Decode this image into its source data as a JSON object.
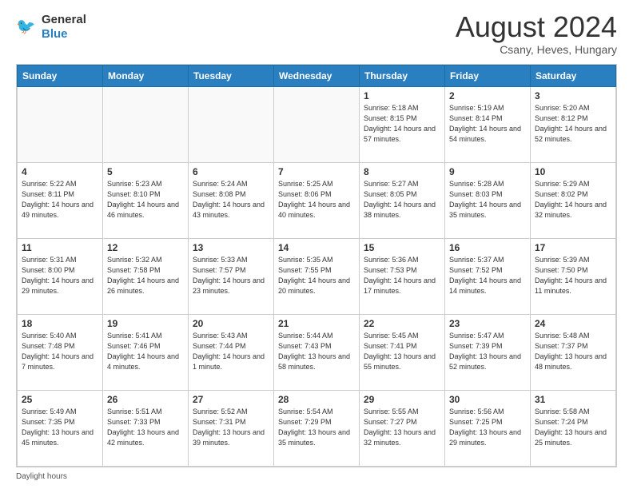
{
  "header": {
    "logo_line1": "General",
    "logo_line2": "Blue",
    "month": "August 2024",
    "location": "Csany, Heves, Hungary"
  },
  "weekdays": [
    "Sunday",
    "Monday",
    "Tuesday",
    "Wednesday",
    "Thursday",
    "Friday",
    "Saturday"
  ],
  "weeks": [
    [
      {
        "day": "",
        "sunrise": "",
        "sunset": "",
        "daylight": "",
        "empty": true
      },
      {
        "day": "",
        "sunrise": "",
        "sunset": "",
        "daylight": "",
        "empty": true
      },
      {
        "day": "",
        "sunrise": "",
        "sunset": "",
        "daylight": "",
        "empty": true
      },
      {
        "day": "",
        "sunrise": "",
        "sunset": "",
        "daylight": "",
        "empty": true
      },
      {
        "day": "1",
        "sunrise": "Sunrise: 5:18 AM",
        "sunset": "Sunset: 8:15 PM",
        "daylight": "Daylight: 14 hours and 57 minutes.",
        "empty": false
      },
      {
        "day": "2",
        "sunrise": "Sunrise: 5:19 AM",
        "sunset": "Sunset: 8:14 PM",
        "daylight": "Daylight: 14 hours and 54 minutes.",
        "empty": false
      },
      {
        "day": "3",
        "sunrise": "Sunrise: 5:20 AM",
        "sunset": "Sunset: 8:12 PM",
        "daylight": "Daylight: 14 hours and 52 minutes.",
        "empty": false
      }
    ],
    [
      {
        "day": "4",
        "sunrise": "Sunrise: 5:22 AM",
        "sunset": "Sunset: 8:11 PM",
        "daylight": "Daylight: 14 hours and 49 minutes.",
        "empty": false
      },
      {
        "day": "5",
        "sunrise": "Sunrise: 5:23 AM",
        "sunset": "Sunset: 8:10 PM",
        "daylight": "Daylight: 14 hours and 46 minutes.",
        "empty": false
      },
      {
        "day": "6",
        "sunrise": "Sunrise: 5:24 AM",
        "sunset": "Sunset: 8:08 PM",
        "daylight": "Daylight: 14 hours and 43 minutes.",
        "empty": false
      },
      {
        "day": "7",
        "sunrise": "Sunrise: 5:25 AM",
        "sunset": "Sunset: 8:06 PM",
        "daylight": "Daylight: 14 hours and 40 minutes.",
        "empty": false
      },
      {
        "day": "8",
        "sunrise": "Sunrise: 5:27 AM",
        "sunset": "Sunset: 8:05 PM",
        "daylight": "Daylight: 14 hours and 38 minutes.",
        "empty": false
      },
      {
        "day": "9",
        "sunrise": "Sunrise: 5:28 AM",
        "sunset": "Sunset: 8:03 PM",
        "daylight": "Daylight: 14 hours and 35 minutes.",
        "empty": false
      },
      {
        "day": "10",
        "sunrise": "Sunrise: 5:29 AM",
        "sunset": "Sunset: 8:02 PM",
        "daylight": "Daylight: 14 hours and 32 minutes.",
        "empty": false
      }
    ],
    [
      {
        "day": "11",
        "sunrise": "Sunrise: 5:31 AM",
        "sunset": "Sunset: 8:00 PM",
        "daylight": "Daylight: 14 hours and 29 minutes.",
        "empty": false
      },
      {
        "day": "12",
        "sunrise": "Sunrise: 5:32 AM",
        "sunset": "Sunset: 7:58 PM",
        "daylight": "Daylight: 14 hours and 26 minutes.",
        "empty": false
      },
      {
        "day": "13",
        "sunrise": "Sunrise: 5:33 AM",
        "sunset": "Sunset: 7:57 PM",
        "daylight": "Daylight: 14 hours and 23 minutes.",
        "empty": false
      },
      {
        "day": "14",
        "sunrise": "Sunrise: 5:35 AM",
        "sunset": "Sunset: 7:55 PM",
        "daylight": "Daylight: 14 hours and 20 minutes.",
        "empty": false
      },
      {
        "day": "15",
        "sunrise": "Sunrise: 5:36 AM",
        "sunset": "Sunset: 7:53 PM",
        "daylight": "Daylight: 14 hours and 17 minutes.",
        "empty": false
      },
      {
        "day": "16",
        "sunrise": "Sunrise: 5:37 AM",
        "sunset": "Sunset: 7:52 PM",
        "daylight": "Daylight: 14 hours and 14 minutes.",
        "empty": false
      },
      {
        "day": "17",
        "sunrise": "Sunrise: 5:39 AM",
        "sunset": "Sunset: 7:50 PM",
        "daylight": "Daylight: 14 hours and 11 minutes.",
        "empty": false
      }
    ],
    [
      {
        "day": "18",
        "sunrise": "Sunrise: 5:40 AM",
        "sunset": "Sunset: 7:48 PM",
        "daylight": "Daylight: 14 hours and 7 minutes.",
        "empty": false
      },
      {
        "day": "19",
        "sunrise": "Sunrise: 5:41 AM",
        "sunset": "Sunset: 7:46 PM",
        "daylight": "Daylight: 14 hours and 4 minutes.",
        "empty": false
      },
      {
        "day": "20",
        "sunrise": "Sunrise: 5:43 AM",
        "sunset": "Sunset: 7:44 PM",
        "daylight": "Daylight: 14 hours and 1 minute.",
        "empty": false
      },
      {
        "day": "21",
        "sunrise": "Sunrise: 5:44 AM",
        "sunset": "Sunset: 7:43 PM",
        "daylight": "Daylight: 13 hours and 58 minutes.",
        "empty": false
      },
      {
        "day": "22",
        "sunrise": "Sunrise: 5:45 AM",
        "sunset": "Sunset: 7:41 PM",
        "daylight": "Daylight: 13 hours and 55 minutes.",
        "empty": false
      },
      {
        "day": "23",
        "sunrise": "Sunrise: 5:47 AM",
        "sunset": "Sunset: 7:39 PM",
        "daylight": "Daylight: 13 hours and 52 minutes.",
        "empty": false
      },
      {
        "day": "24",
        "sunrise": "Sunrise: 5:48 AM",
        "sunset": "Sunset: 7:37 PM",
        "daylight": "Daylight: 13 hours and 48 minutes.",
        "empty": false
      }
    ],
    [
      {
        "day": "25",
        "sunrise": "Sunrise: 5:49 AM",
        "sunset": "Sunset: 7:35 PM",
        "daylight": "Daylight: 13 hours and 45 minutes.",
        "empty": false
      },
      {
        "day": "26",
        "sunrise": "Sunrise: 5:51 AM",
        "sunset": "Sunset: 7:33 PM",
        "daylight": "Daylight: 13 hours and 42 minutes.",
        "empty": false
      },
      {
        "day": "27",
        "sunrise": "Sunrise: 5:52 AM",
        "sunset": "Sunset: 7:31 PM",
        "daylight": "Daylight: 13 hours and 39 minutes.",
        "empty": false
      },
      {
        "day": "28",
        "sunrise": "Sunrise: 5:54 AM",
        "sunset": "Sunset: 7:29 PM",
        "daylight": "Daylight: 13 hours and 35 minutes.",
        "empty": false
      },
      {
        "day": "29",
        "sunrise": "Sunrise: 5:55 AM",
        "sunset": "Sunset: 7:27 PM",
        "daylight": "Daylight: 13 hours and 32 minutes.",
        "empty": false
      },
      {
        "day": "30",
        "sunrise": "Sunrise: 5:56 AM",
        "sunset": "Sunset: 7:25 PM",
        "daylight": "Daylight: 13 hours and 29 minutes.",
        "empty": false
      },
      {
        "day": "31",
        "sunrise": "Sunrise: 5:58 AM",
        "sunset": "Sunset: 7:24 PM",
        "daylight": "Daylight: 13 hours and 25 minutes.",
        "empty": false
      }
    ]
  ],
  "footer": {
    "label": "Daylight hours"
  }
}
